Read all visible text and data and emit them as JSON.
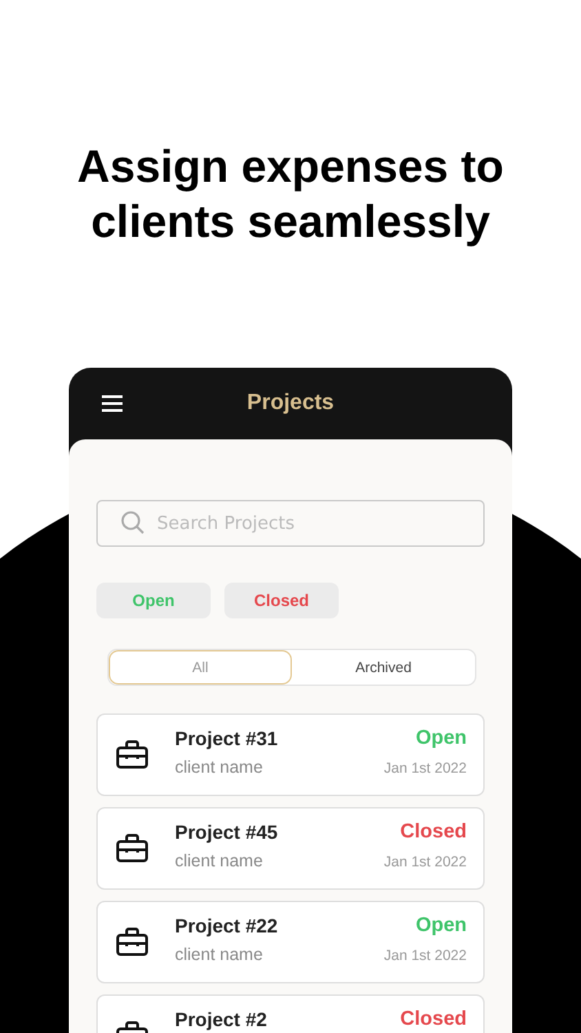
{
  "headline": "Assign expenses to clients seamlessly",
  "app_bar": {
    "title": "Projects"
  },
  "search": {
    "placeholder": "Search Projects"
  },
  "status_filters": [
    {
      "label": "Open",
      "kind": "open"
    },
    {
      "label": "Closed",
      "kind": "closed"
    }
  ],
  "segments": [
    {
      "label": "All",
      "selected": true
    },
    {
      "label": "Archived",
      "selected": false
    }
  ],
  "projects": [
    {
      "name": "Project #31",
      "client": "client name",
      "status": "Open",
      "kind": "open",
      "date": "Jan 1st 2022"
    },
    {
      "name": "Project #45",
      "client": "client name",
      "status": "Closed",
      "kind": "closed",
      "date": "Jan 1st 2022"
    },
    {
      "name": "Project #22",
      "client": "client name",
      "status": "Open",
      "kind": "open",
      "date": "Jan 1st 2022"
    },
    {
      "name": "Project #2",
      "status": "Closed",
      "kind": "closed"
    }
  ]
}
